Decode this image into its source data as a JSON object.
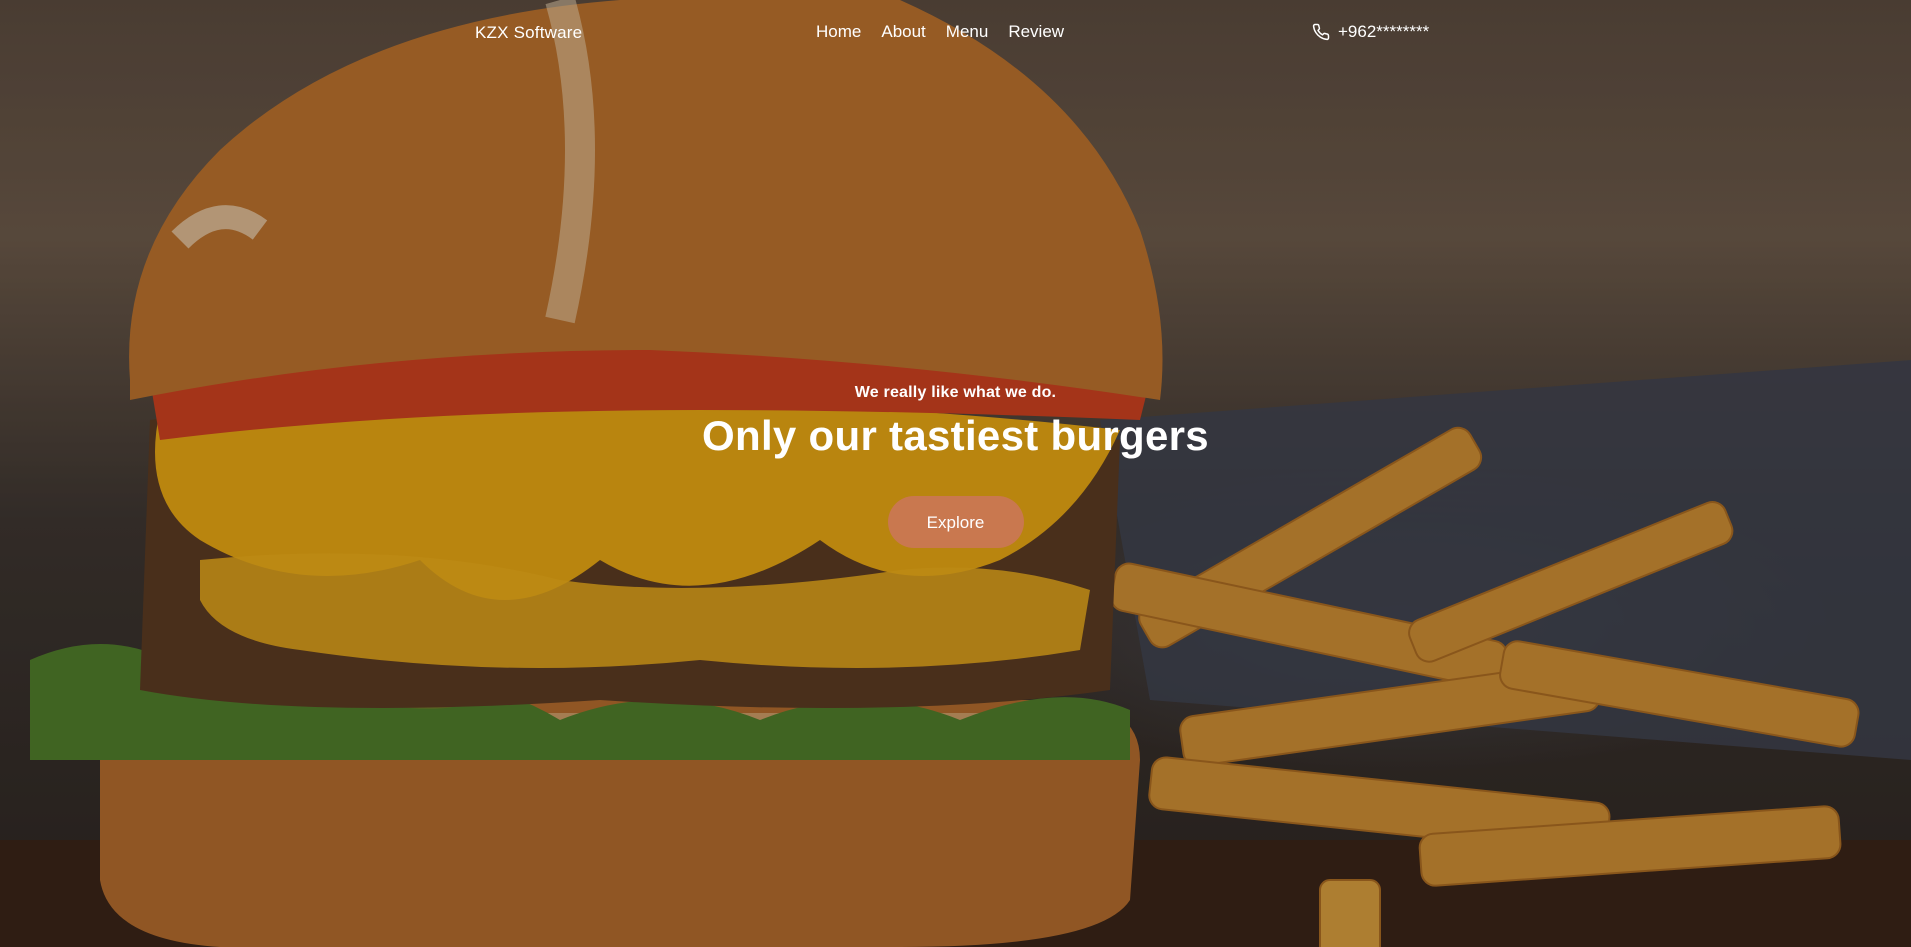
{
  "nav": {
    "brand": "KZX Software",
    "links": [
      "Home",
      "About",
      "Menu",
      "Review"
    ],
    "phone": "+962********",
    "phone_icon": "phone-icon"
  },
  "hero": {
    "tagline": "We really like what we do.",
    "headline": "Only our tastiest burgers",
    "button_label": "Explore",
    "button_color": "#c9784f",
    "background_image": "burger-and-fries-photo"
  }
}
